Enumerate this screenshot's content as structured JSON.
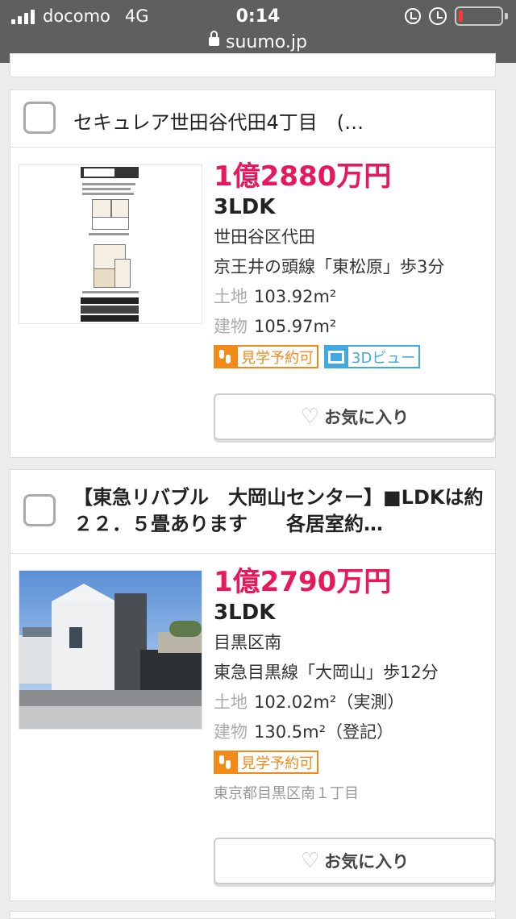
{
  "status_bar": {
    "carrier": "docomo",
    "network": "4G",
    "time": "0:14"
  },
  "browser": {
    "url": "suumo.jp"
  },
  "icons": {
    "lock": "lock-icon",
    "orientation": "orientation-lock-icon",
    "alarm": "alarm-icon",
    "battery": "battery-icon",
    "heart": "heart-icon",
    "footprints": "footprints-icon",
    "cube": "3d-cube-icon"
  },
  "colors": {
    "price": "#e8185c",
    "tag_orange": "#f28a1a",
    "tag_blue": "#3fa9e0"
  },
  "listings": [
    {
      "title": "セキュレア世田谷代田4丁目　(…",
      "price": "1億2880万円",
      "layout": "3LDK",
      "location": "世田谷区代田",
      "access": "京王井の頭線「東松原」歩3分",
      "land_label": "土地",
      "land_area": "103.92m²",
      "building_label": "建物",
      "building_area": "105.97m²",
      "tags": [
        "見学予約可",
        "3Dビュー"
      ],
      "favorite_label": "お気に入り"
    },
    {
      "title": "【東急リバブル　大岡山センター】■LDKは約２２．５畳あります　　各居室約…",
      "price": "1億2790万円",
      "layout": "3LDK",
      "location": "目黒区南",
      "access": "東急目黒線「大岡山」歩12分",
      "land_label": "土地",
      "land_area": "102.02m²（実測）",
      "building_label": "建物",
      "building_area": "130.5m²（登記）",
      "tags": [
        "見学予約可"
      ],
      "address": "東京都目黒区南１丁目",
      "favorite_label": "お気に入り"
    }
  ]
}
